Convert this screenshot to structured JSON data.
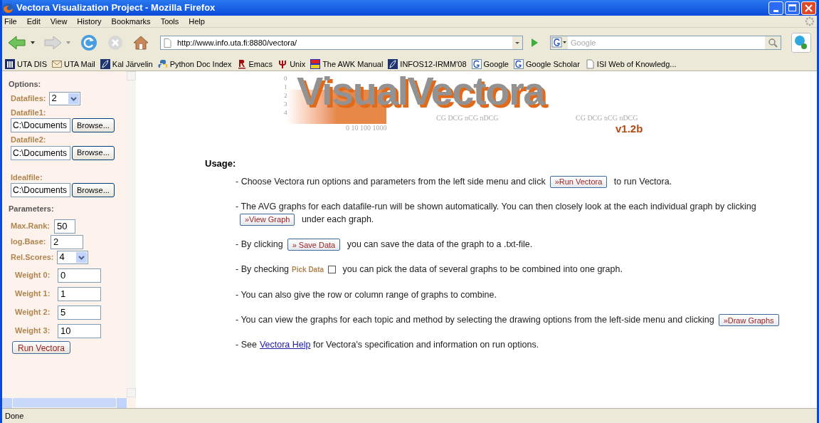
{
  "window": {
    "title": "Vectora Visualization Project - Mozilla Firefox"
  },
  "menu": [
    "File",
    "Edit",
    "View",
    "History",
    "Bookmarks",
    "Tools",
    "Help"
  ],
  "address": {
    "value": "http://www.info.uta.fi:8880/vectora/"
  },
  "search": {
    "placeholder": "Google"
  },
  "bookmarks": [
    {
      "label": "UTA DIS",
      "kind": "building"
    },
    {
      "label": "UTA Mail",
      "kind": "mail"
    },
    {
      "label": "Kal Järvelin",
      "kind": "leaf"
    },
    {
      "label": "Python Doc Index",
      "kind": "python"
    },
    {
      "label": "Emacs",
      "kind": "r"
    },
    {
      "label": "Unix",
      "kind": "trident"
    },
    {
      "label": "The AWK Manual",
      "kind": "flag"
    },
    {
      "label": "INFOS12-IRMM'08",
      "kind": "leaf"
    },
    {
      "label": "Google",
      "kind": "g"
    },
    {
      "label": "Google Scholar",
      "kind": "g"
    },
    {
      "label": "ISI Web of Knowledg...",
      "kind": "page"
    }
  ],
  "sidebar": {
    "options_heading": "Options:",
    "datafiles": {
      "label": "Datafiles:",
      "value": "2"
    },
    "files": [
      {
        "label": "Datafile1:",
        "value": "C:\\Documents",
        "button": "Browse..."
      },
      {
        "label": "Datafile2:",
        "value": "C:\\Documents",
        "button": "Browse..."
      },
      {
        "label": "Idealfile:",
        "value": "C:\\Documents",
        "button": "Browse..."
      }
    ],
    "parameters_heading": "Parameters:",
    "max_rank": {
      "label": "Max.Rank:",
      "value": "50"
    },
    "log_base": {
      "label": "log.Base:",
      "value": "2"
    },
    "rel_scores": {
      "label": "Rel.Scores:",
      "value": "4"
    },
    "weights": [
      {
        "label": "Weight 0:",
        "value": "0"
      },
      {
        "label": "Weight 1:",
        "value": "1"
      },
      {
        "label": "Weight 2:",
        "value": "5"
      },
      {
        "label": "Weight 3:",
        "value": "10"
      }
    ],
    "run_button": "Run Vectora"
  },
  "logo": {
    "title_1": "Visual",
    "title_2": "Vectora",
    "version": "v1.2b",
    "axis": [
      "0",
      "1",
      "2",
      "3",
      "4"
    ],
    "scale": "0 10 100 1000",
    "legend_1": "CG DCG nCG nDCG",
    "legend_2": "CG DCG nCG nDCG"
  },
  "usage_heading": "Usage:",
  "paragraphs": [
    [
      {
        "kind": "text",
        "text": "- Choose Vectora run options and parameters from the left side menu and click"
      },
      {
        "kind": "button",
        "text": "»Run Vectora"
      },
      {
        "kind": "text",
        "text": "to run Vectora."
      }
    ],
    [
      {
        "kind": "text",
        "text": "- The AVG graphs for each datafile-run will be shown automatically. You can then closely look at the each individual graph by clicking"
      },
      {
        "kind": "button",
        "text": "»View Graph"
      },
      {
        "kind": "text",
        "text": "under each graph."
      }
    ],
    [
      {
        "kind": "text",
        "text": "- By clicking"
      },
      {
        "kind": "button",
        "text": "» Save Data"
      },
      {
        "kind": "text",
        "text": "you can save the data of the graph to a .txt-file."
      }
    ],
    [
      {
        "kind": "text",
        "text": "- By checking"
      },
      {
        "kind": "label",
        "text": "Pick Data"
      },
      {
        "kind": "checkbox",
        "checked": false
      },
      {
        "kind": "text",
        "text": "you can pick the data of several graphs to be combined into one graph."
      }
    ],
    [
      {
        "kind": "text",
        "text": "- You can also give the row or column range of graphs to combine."
      }
    ],
    [
      {
        "kind": "text",
        "text": "- You can view the graphs for each topic and method by selecting the drawing options from the left-side menu and clicking"
      },
      {
        "kind": "button",
        "text": "»Draw Graphs"
      }
    ],
    [
      {
        "kind": "text",
        "text": "- See"
      },
      {
        "kind": "link",
        "text": "Vectora Help"
      },
      {
        "kind": "text",
        "text": "for Vectora's specification and information on run options."
      }
    ]
  ],
  "status_bar": "Done"
}
